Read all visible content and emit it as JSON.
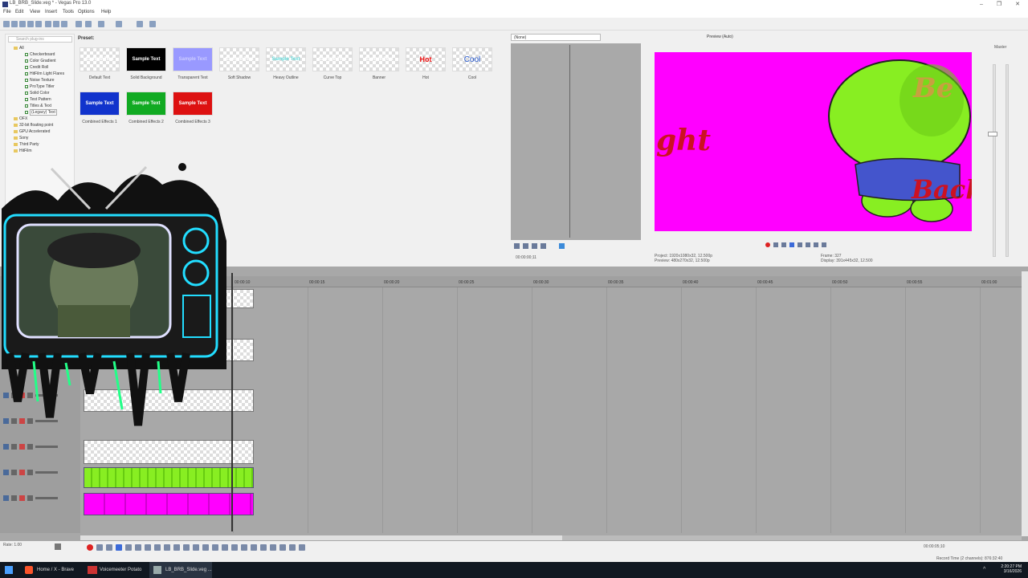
{
  "window": {
    "title": "LB_BRB_Slide.veg * - Vegas Pro 13.0",
    "min": "–",
    "max": "❐",
    "close": "✕"
  },
  "menu": [
    "File",
    "Edit",
    "View",
    "Insert",
    "Tools",
    "Options",
    "Help"
  ],
  "plugins": {
    "search_placeholder": "Search plug-ins",
    "tree": [
      {
        "label": "All",
        "type": "folder"
      },
      {
        "label": "Checkerboard",
        "type": "item"
      },
      {
        "label": "Color Gradient",
        "type": "item"
      },
      {
        "label": "Credit Roll",
        "type": "item"
      },
      {
        "label": "HitFilm Light Flares",
        "type": "item"
      },
      {
        "label": "Noise Texture",
        "type": "item"
      },
      {
        "label": "ProType Titler",
        "type": "item"
      },
      {
        "label": "Solid Color",
        "type": "item"
      },
      {
        "label": "Test Pattern",
        "type": "item"
      },
      {
        "label": "Titles & Text",
        "type": "item"
      },
      {
        "label": "(Legacy) Text",
        "type": "item",
        "selected": true
      },
      {
        "label": "OFX",
        "type": "folder"
      },
      {
        "label": "32-bit floating point",
        "type": "folder"
      },
      {
        "label": "GPU Accelerated",
        "type": "folder"
      },
      {
        "label": "Sony",
        "type": "folder"
      },
      {
        "label": "Third Party",
        "type": "folder"
      },
      {
        "label": "HitFilm",
        "type": "folder"
      }
    ]
  },
  "presets": {
    "header": "Preset:",
    "items": [
      {
        "label": "Default Text",
        "thumb": "Sample Text",
        "style": "checker",
        "color": "#ffffff"
      },
      {
        "label": "Solid Background",
        "thumb": "Sample Text",
        "style": "solid",
        "bg": "#000000",
        "color": "#ffffff"
      },
      {
        "label": "Transparent Text",
        "thumb": "Sample Text",
        "style": "solid",
        "bg": "#9999ff",
        "color": "#ccccff"
      },
      {
        "label": "Soft Shadow",
        "thumb": "Sample Text",
        "style": "checker",
        "color": "#ffffff"
      },
      {
        "label": "Heavy Outline",
        "thumb": "Sample Text",
        "style": "checker",
        "color": "#66dddd"
      },
      {
        "label": "Curve Top",
        "thumb": "Sample Text",
        "style": "checker",
        "color": "#ffffff"
      },
      {
        "label": "Banner",
        "thumb": "Sample Text",
        "style": "checker",
        "color": "#ffffff"
      },
      {
        "label": "Hot",
        "thumb": "Hot",
        "style": "checker",
        "color": "#ee1111"
      },
      {
        "label": "Cool",
        "thumb": "Cool",
        "style": "checker",
        "color": "#2255cc"
      },
      {
        "label": "Combined Effects 1",
        "thumb": "Sample Text",
        "style": "solid",
        "bg": "#1133cc",
        "color": "#ffffff"
      },
      {
        "label": "Combined Effects 2",
        "thumb": "Sample Text",
        "style": "solid",
        "bg": "#11aa22",
        "color": "#ffffff"
      },
      {
        "label": "Combined Effects 3",
        "thumb": "Sample Text",
        "style": "solid",
        "bg": "#dd1111",
        "color": "#ffffff"
      }
    ]
  },
  "trimmer": {
    "selector": "(None)",
    "time": "00:00:00;11"
  },
  "preview": {
    "mode": "Preview (Auto)",
    "project_label": "Project:",
    "project_value": "1920x1080x32, 12.500p",
    "preview_label": "Preview:",
    "preview_value": "480x270x32, 12.500p",
    "frame_label": "Frame:",
    "frame_value": "327",
    "display_label": "Display:",
    "display_value": "391x445x32, 12.500",
    "overlay_left": "ght",
    "overlay_top": "Be",
    "overlay_right": "Back"
  },
  "master": {
    "label": "Master"
  },
  "timeline": {
    "ruler": [
      "00:00:10",
      "00:00:15",
      "00:00:20",
      "00:00:25",
      "00:00:30",
      "00:00:35",
      "00:00:40",
      "00:00:45",
      "00:00:50",
      "00:00:55",
      "00:01:00"
    ],
    "cursor_time": "00:00:05;10"
  },
  "status": {
    "rate": "Rate: 1.00",
    "record": "Record Time (2 channels): 876:32:40"
  },
  "taskbar": {
    "items": [
      "Home / X - Brave",
      "Voicemeeter Potato",
      "LB_BRB_Slide.veg ..."
    ],
    "time": "2:20:27 PM",
    "date": "3/16/2026"
  },
  "colors": {
    "chroma": "#ff00ff",
    "lime": "#88ee22",
    "accent": "#0078d7"
  }
}
